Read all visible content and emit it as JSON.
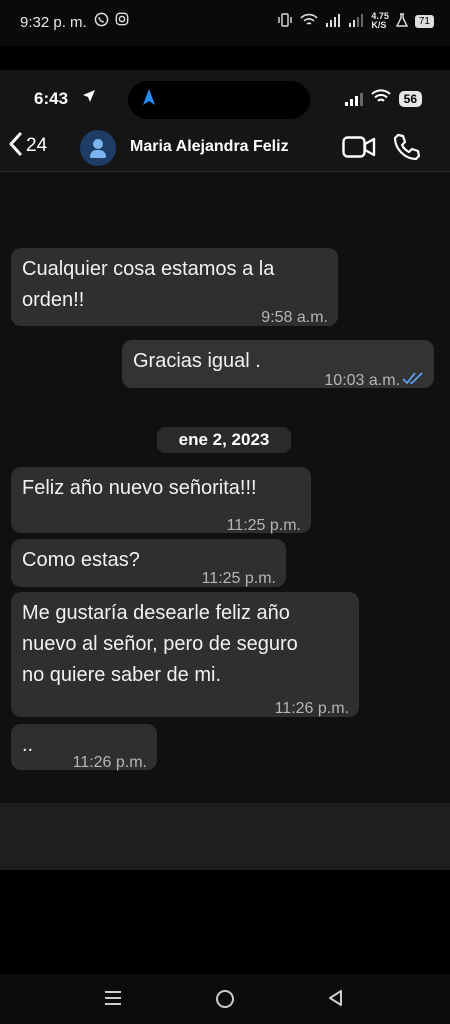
{
  "outer_status": {
    "time": "9:32 p. m.",
    "net_speed": "4.75",
    "net_unit": "K/S",
    "battery": "71"
  },
  "ios_status": {
    "time": "6:43",
    "battery": "56"
  },
  "header": {
    "back_count": "24",
    "contact_name": "Maria Alejandra Feliz"
  },
  "messages": [
    {
      "text": "Cualquier cosa estamos a la\norden!!",
      "time": "9:58 a.m.",
      "direction": "in"
    },
    {
      "text": "Gracias igual .",
      "time": "10:03 a.m.",
      "direction": "out",
      "read": true
    },
    {
      "text": "Feliz año nuevo señorita!!!",
      "time": "11:25 p.m.",
      "direction": "in"
    },
    {
      "text": "Como estas?",
      "time": "11:25 p.m.",
      "direction": "in"
    },
    {
      "text": "Me gustaría desearle feliz año\nnuevo al señor, pero de seguro\nno quiere saber de mi.",
      "time": "11:26 p.m.",
      "direction": "in"
    },
    {
      "text": "..",
      "time": "11:26 p.m.",
      "direction": "in"
    }
  ],
  "date_separator": "ene 2, 2023",
  "colors": {
    "bubble": "#2f2f2f",
    "read_tick": "#5da6ff",
    "nav_arrow": "#1f8fff"
  },
  "icons": [
    "whatsapp-icon",
    "instagram-icon",
    "vibrate-icon",
    "wifi-icon",
    "signal-icon",
    "location-arrow-icon",
    "video-call-icon",
    "phone-icon",
    "back-chevron-icon",
    "menu-icon",
    "home-icon",
    "back-triangle-icon"
  ]
}
